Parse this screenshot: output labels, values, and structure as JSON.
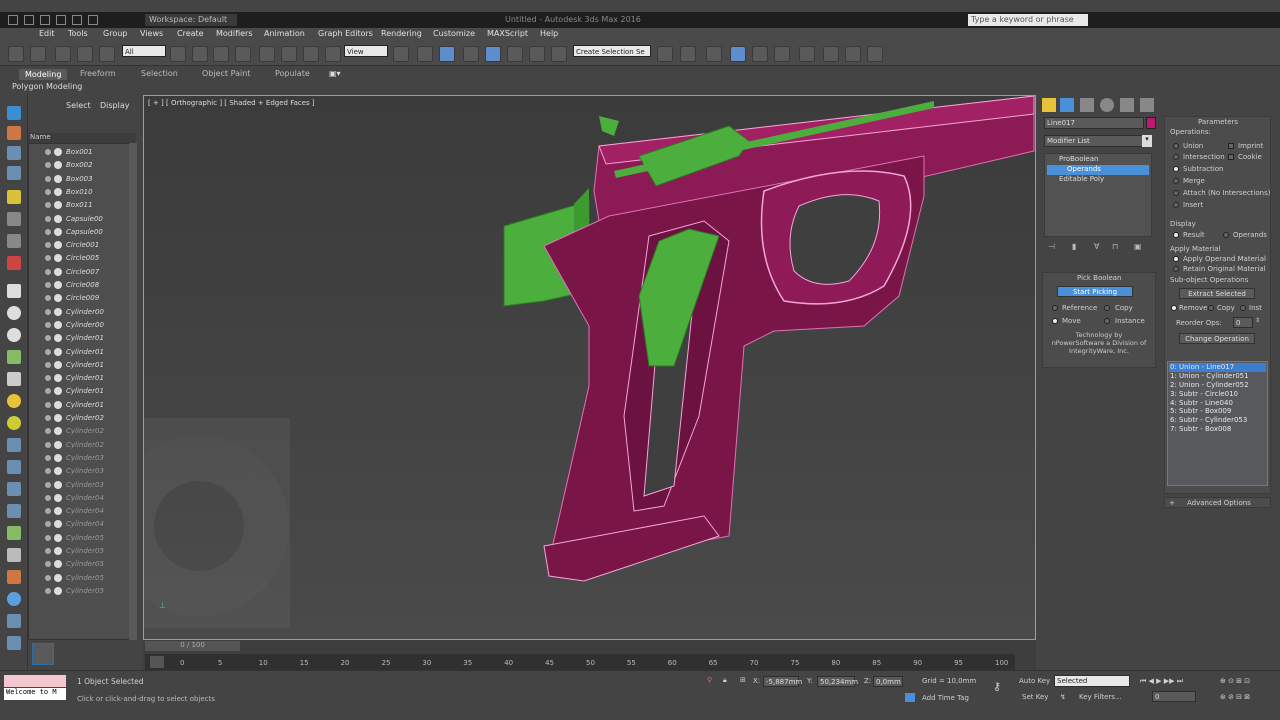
{
  "titlebar": {
    "workspace": "Workspace: Default",
    "document": "Untitled - Autodesk 3ds Max 2016",
    "search_placeholder": "Type a keyword or phrase"
  },
  "menu": [
    "Edit",
    "Tools",
    "Group",
    "Views",
    "Create",
    "Modifiers",
    "Animation",
    "Graph Editors",
    "Rendering",
    "Customize",
    "MAXScript",
    "Help"
  ],
  "toolbar": {
    "selection_filter": "All",
    "ref_coord": "View",
    "named_selection": "Create Selection Se"
  },
  "ribbon": {
    "tabs": [
      "Modeling",
      "Freeform",
      "Selection",
      "Object Paint",
      "Populate"
    ],
    "active_tab": "Modeling",
    "sub": "Polygon Modeling"
  },
  "explorer": {
    "tabs": [
      "Select",
      "Display"
    ],
    "column": "Name",
    "items": [
      "Box001",
      "Box002",
      "Box003",
      "Box010",
      "Box011",
      "Capsule00",
      "Capsule00",
      "Circle001",
      "Circle005",
      "Circle007",
      "Circle008",
      "Circle009",
      "Cylinder00",
      "Cylinder00",
      "Cylinder01",
      "Cylinder01",
      "Cylinder01",
      "Cylinder01",
      "Cylinder01",
      "Cylinder01",
      "Cylinder02",
      "Cylinder02",
      "Cylinder02",
      "Cylinder03",
      "Cylinder03",
      "Cylinder03",
      "Cylinder04",
      "Cylinder04",
      "Cylinder04",
      "Cylinder05",
      "Cylinder05",
      "Cylinder05",
      "Cylinder05",
      "Cylinder05"
    ]
  },
  "viewport": {
    "label": "[ + ] [ Orthographic ] [ Shaded + Edged Faces ]"
  },
  "command_panel": {
    "object_name": "Line017",
    "modifier_list": "Modifier List",
    "stack": [
      "ProBoolean",
      "Operands",
      "Editable Poly"
    ],
    "pick_boolean": {
      "title": "Pick Boolean",
      "start_picking": "Start Picking",
      "options": [
        "Reference",
        "Copy",
        "Move",
        "Instance"
      ],
      "credit": "Technology by nPowerSoftware a Division of IntegrityWare, Inc."
    },
    "parameters": {
      "title": "Parameters",
      "operations_label": "Operations:",
      "operations": [
        "Union",
        "Intersection",
        "Subtraction",
        "Merge",
        "Attach (No Intersections)",
        "Insert"
      ],
      "imprint": "Imprint",
      "cookie": "Cookie",
      "display_label": "Display",
      "display_options": [
        "Result",
        "Operands"
      ],
      "apply_material_label": "Apply Material",
      "apply_material": [
        "Apply Operand Material",
        "Retain Original Material"
      ],
      "subobj_label": "Sub-object Operations",
      "extract_selected": "Extract Selected",
      "extract_options": [
        "Remove",
        "Copy",
        "Inst"
      ],
      "reorder_label": "Reorder Ops:",
      "reorder_value": "0",
      "change_operation": "Change Operation",
      "ops_list": [
        "0: Union - Line017",
        "1: Union - Cylinder051",
        "2: Union - Cylinder052",
        "3: Subtr - Circle010",
        "4: Subtr - Line040",
        "5: Subtr - Box009",
        "6: Subtr - Cylinder053",
        "7: Subtr - Box008"
      ],
      "advanced": "Advanced Options"
    }
  },
  "timeline": {
    "slider": "0 / 100",
    "ticks": [
      "0",
      "5",
      "10",
      "15",
      "20",
      "25",
      "30",
      "35",
      "40",
      "45",
      "50",
      "55",
      "60",
      "65",
      "70",
      "75",
      "80",
      "85",
      "90",
      "95",
      "100"
    ]
  },
  "status": {
    "maxscript": "Welcome to M",
    "selected": "1 Object Selected",
    "prompt": "Click or click-and-drag to select objects",
    "x": "-5,887mm",
    "y": "50,234mm",
    "z": "0,0mm",
    "grid": "Grid = 10,0mm",
    "add_time_tag": "Add Time Tag",
    "auto_key": "Auto Key",
    "selected_dd": "Selected",
    "set_key": "Set Key",
    "key_filters": "Key Filters...",
    "frame": "0"
  }
}
